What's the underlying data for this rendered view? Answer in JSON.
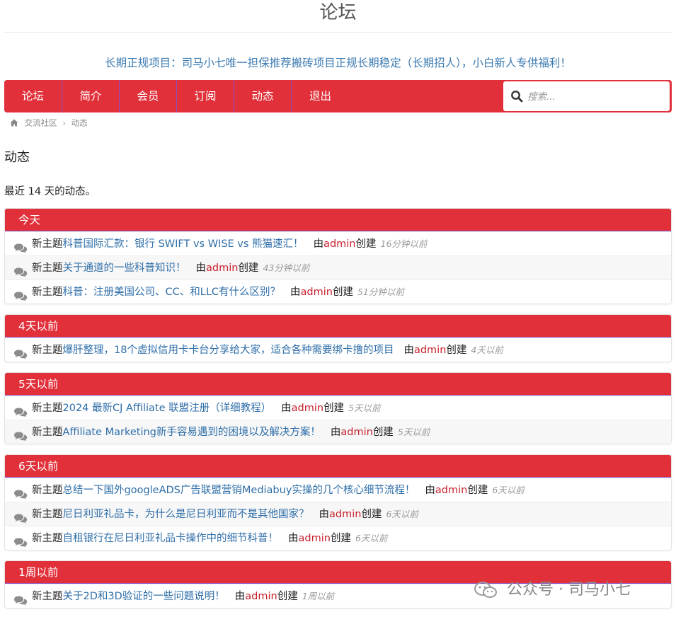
{
  "site": {
    "title": "论坛"
  },
  "promo": "长期正规项目：司马小七唯一担保推荐搬砖项目正规长期稳定（长期招人），小白新人专供福利！",
  "nav": {
    "items": [
      {
        "label": "论坛"
      },
      {
        "label": "简介"
      },
      {
        "label": "会员"
      },
      {
        "label": "订阅"
      },
      {
        "label": "动态"
      },
      {
        "label": "退出"
      }
    ],
    "search_placeholder": "搜索..."
  },
  "breadcrumb": {
    "home": "交流社区",
    "current": "动态"
  },
  "page": {
    "title": "动态",
    "subtitle": "最近 14 天的动态。"
  },
  "labels": {
    "new_topic": "新主题",
    "by": "由",
    "created": "创建"
  },
  "groups": [
    {
      "label": "今天",
      "items": [
        {
          "title": "科普国际汇款：银行 SWIFT vs WISE vs 熊猫速汇！",
          "user": "admin",
          "time": "16分钟以前"
        },
        {
          "title": "关于通道的一些科普知识！",
          "user": "admin",
          "time": "43分钟以前"
        },
        {
          "title": "科普：注册美国公司、CC、和LLC有什么区别？",
          "user": "admin",
          "time": "51分钟以前"
        }
      ]
    },
    {
      "label": "4天以前",
      "items": [
        {
          "title": "爆肝整理，18个虚拟信用卡卡台分享给大家，适合各种需要绑卡撸的项目",
          "user": "admin",
          "time": "4天以前"
        }
      ]
    },
    {
      "label": "5天以前",
      "items": [
        {
          "title": "2024 最新CJ Affiliate 联盟注册（详细教程）",
          "user": "admin",
          "time": "5天以前"
        },
        {
          "title": "Affiliate Marketing新手容易遇到的困境以及解决方案！",
          "user": "admin",
          "time": "5天以前"
        }
      ]
    },
    {
      "label": "6天以前",
      "items": [
        {
          "title": "总结一下国外googleADS广告联盟营销Mediabuy实操的几个核心细节流程！",
          "user": "admin",
          "time": "6天以前"
        },
        {
          "title": "尼日利亚礼品卡，为什么是尼日利亚而不是其他国家？",
          "user": "admin",
          "time": "6天以前"
        },
        {
          "title": "自租银行在尼日利亚礼品卡操作中的细节科普！",
          "user": "admin",
          "time": "6天以前"
        }
      ]
    },
    {
      "label": "1周以前",
      "items": [
        {
          "title": "关于2D和3D验证的一些问题说明！",
          "user": "admin",
          "time": "1周以前"
        }
      ]
    }
  ],
  "watermark": "公众号 · 司马小七",
  "colors": {
    "accent": "#e1303a",
    "link": "#2e6ea8",
    "user": "#c8202b",
    "promo": "#3a7ab0"
  }
}
